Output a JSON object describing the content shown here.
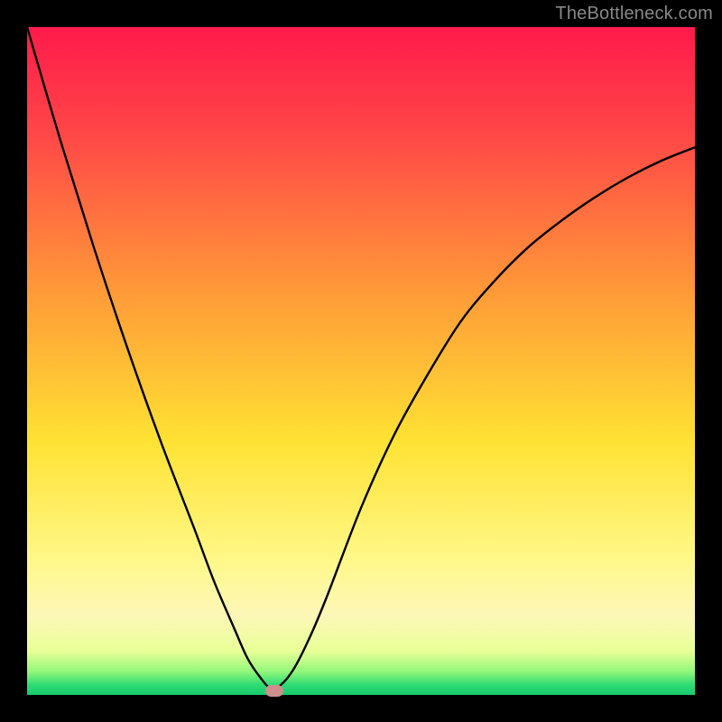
{
  "watermark": "TheBottleneck.com",
  "chart_data": {
    "type": "line",
    "title": "",
    "xlabel": "",
    "ylabel": "",
    "xlim": [
      0,
      100
    ],
    "ylim": [
      0,
      100
    ],
    "grid": false,
    "legend": false,
    "gradient_stops": [
      {
        "offset": 0.0,
        "color": "#ff1a4b"
      },
      {
        "offset": 0.16,
        "color": "#ff4747"
      },
      {
        "offset": 0.4,
        "color": "#ff9b38"
      },
      {
        "offset": 0.62,
        "color": "#ffe233"
      },
      {
        "offset": 0.8,
        "color": "#fff88a"
      },
      {
        "offset": 0.88,
        "color": "#fdf7b8"
      },
      {
        "offset": 0.935,
        "color": "#e8ff96"
      },
      {
        "offset": 0.965,
        "color": "#92f77a"
      },
      {
        "offset": 0.985,
        "color": "#2ddc74"
      },
      {
        "offset": 1.0,
        "color": "#18c96e"
      }
    ],
    "series": [
      {
        "name": "bottleneck-curve",
        "color": "#000000",
        "x": [
          0,
          5,
          10,
          15,
          20,
          25,
          28,
          31,
          33,
          35,
          36.5,
          38,
          40,
          42.5,
          45,
          50,
          55,
          60,
          65,
          70,
          75,
          80,
          85,
          90,
          95,
          100
        ],
        "y": [
          100,
          83,
          67,
          52,
          38,
          25,
          17,
          10,
          5.5,
          2.5,
          1,
          1.5,
          4,
          9,
          15,
          28,
          39,
          48,
          56,
          62,
          67,
          71,
          74.5,
          77.5,
          80,
          82
        ]
      }
    ],
    "marker": {
      "x": 37,
      "y": 0.7,
      "color": "#cf8e8e"
    }
  }
}
